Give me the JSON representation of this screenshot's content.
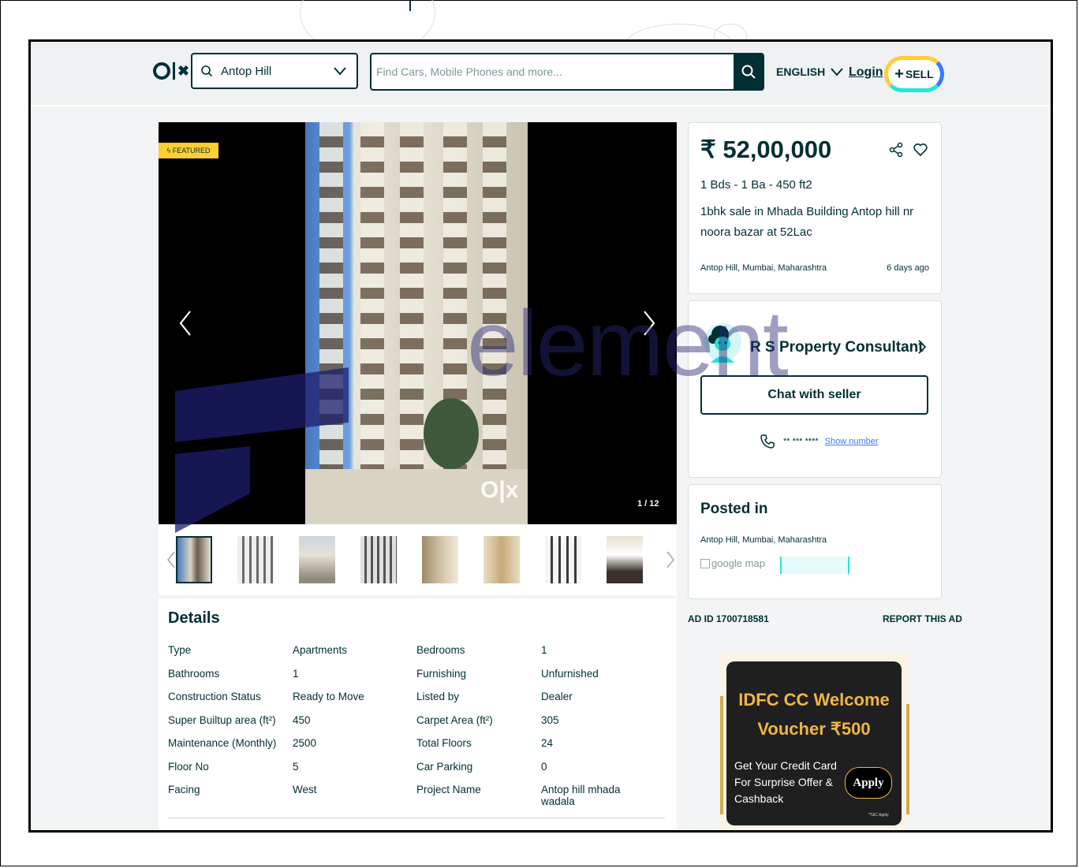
{
  "header": {
    "logo": "OLX",
    "location_value": "Antop Hill",
    "search_placeholder": "Find Cars, Mobile Phones and more...",
    "language": "ENGLISH",
    "login": "Login",
    "sell": "SELL"
  },
  "gallery": {
    "featured": "FEATURED",
    "counter": "1 / 12",
    "watermark": "O|x",
    "thumbnail_count": 8
  },
  "details": {
    "title": "Details",
    "rows": [
      {
        "k1": "Type",
        "v1": "Apartments",
        "k2": "Bedrooms",
        "v2": "1"
      },
      {
        "k1": "Bathrooms",
        "v1": "1",
        "k2": "Furnishing",
        "v2": "Unfurnished"
      },
      {
        "k1": "Construction Status",
        "v1": "Ready to Move",
        "k2": "Listed by",
        "v2": "Dealer"
      },
      {
        "k1": "Super Builtup area (ft²)",
        "v1": "450",
        "k2": "Carpet Area (ft²)",
        "v2": "305"
      },
      {
        "k1": "Maintenance (Monthly)",
        "v1": "2500",
        "k2": "Total Floors",
        "v2": "24"
      },
      {
        "k1": "Floor No",
        "v1": "5",
        "k2": "Car Parking",
        "v2": "0"
      },
      {
        "k1": "Facing",
        "v1": "West",
        "k2": "Project Name",
        "v2": "Antop hill mhada wadala"
      }
    ]
  },
  "listing": {
    "price": "₹ 52,00,000",
    "spec": "1 Bds - 1 Ba - 450 ft2",
    "description": "1bhk sale in Mhada Building Antop hill nr noora bazar at 52Lac",
    "location": "Antop Hill, Mumbai, Maharashtra",
    "posted_ago": "6 days ago"
  },
  "seller": {
    "name": "R S Property Consultant",
    "chat": "Chat with seller",
    "masked_number": "** *** ****",
    "show_number": "Show number"
  },
  "posted": {
    "title": "Posted in",
    "location": "Antop Hill, Mumbai, Maharashtra",
    "map_alt": "google map"
  },
  "ad_meta": {
    "ad_id": "AD ID 1700718581",
    "report": "REPORT THIS AD"
  },
  "banner": {
    "title": "IDFC CC Welcome Voucher ₹500",
    "body": "Get Your Credit Card For Surprise Offer & Cashback",
    "apply": "Apply",
    "tc": "*T&C Apply"
  },
  "watermark": {
    "text": "element"
  },
  "colors": {
    "brand": "#002f34",
    "featured": "#ffce32",
    "link": "#3a77ff",
    "ad_gold": "#f3b543"
  }
}
